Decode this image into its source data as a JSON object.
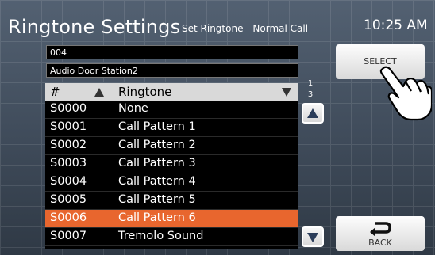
{
  "header": {
    "title": "Ringtone Settings",
    "subtitle": "Set Ringtone - Normal Call",
    "time": "10:25 AM"
  },
  "fields": {
    "station_number": "004",
    "station_name": "Audio Door Station2"
  },
  "table": {
    "columns": [
      "#",
      "Ringtone"
    ],
    "rows": [
      {
        "id": "S0000",
        "name": "None",
        "selected": false
      },
      {
        "id": "S0001",
        "name": "Call Pattern 1",
        "selected": false
      },
      {
        "id": "S0002",
        "name": "Call Pattern 2",
        "selected": false
      },
      {
        "id": "S0003",
        "name": "Call Pattern 3",
        "selected": false
      },
      {
        "id": "S0004",
        "name": "Call Pattern 4",
        "selected": false
      },
      {
        "id": "S0005",
        "name": "Call Pattern 5",
        "selected": false
      },
      {
        "id": "S0006",
        "name": "Call Pattern 6",
        "selected": true
      },
      {
        "id": "S0007",
        "name": "Tremolo Sound",
        "selected": false
      }
    ],
    "selected_color": "#e8662e"
  },
  "pagination": {
    "current": "1",
    "total": "3"
  },
  "buttons": {
    "select_label": "SELECT",
    "back_label": "BACK"
  },
  "icons": {
    "scroll_up": "triangle-up-icon",
    "scroll_down": "triangle-down-icon",
    "back": "return-arrow-icon",
    "pointer": "pointing-hand-icon"
  }
}
